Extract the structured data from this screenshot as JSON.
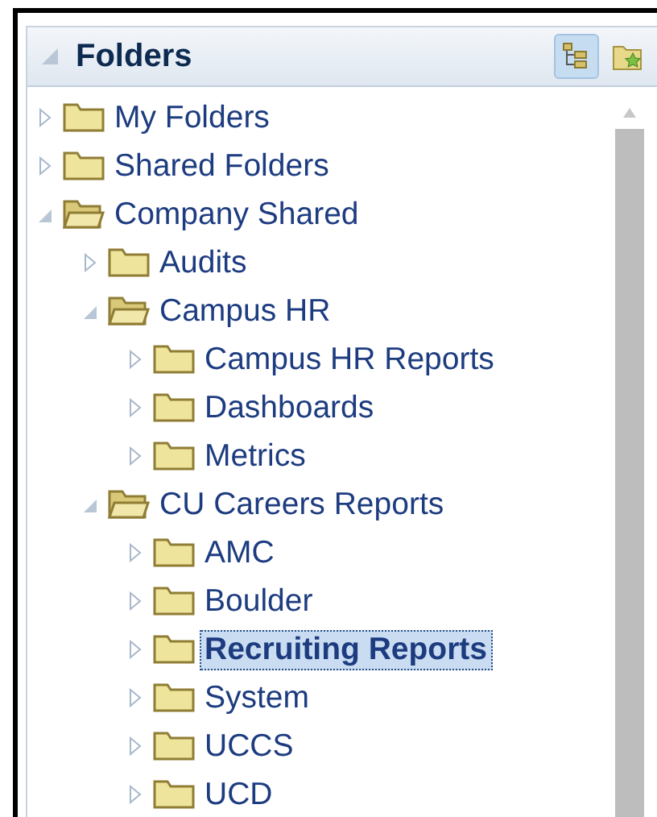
{
  "panel": {
    "title": "Folders",
    "tools": [
      {
        "kind": "tree",
        "selected": true
      },
      {
        "kind": "favorites",
        "selected": false
      }
    ]
  },
  "tree": [
    {
      "label": "My Folders",
      "expanded": false,
      "selected": false
    },
    {
      "label": "Shared Folders",
      "expanded": false,
      "selected": false
    },
    {
      "label": "Company Shared",
      "expanded": true,
      "selected": false,
      "children": [
        {
          "label": "Audits",
          "expanded": false,
          "selected": false
        },
        {
          "label": "Campus HR",
          "expanded": true,
          "selected": false,
          "children": [
            {
              "label": "Campus HR Reports",
              "expanded": false,
              "selected": false
            },
            {
              "label": "Dashboards",
              "expanded": false,
              "selected": false
            },
            {
              "label": "Metrics",
              "expanded": false,
              "selected": false
            }
          ]
        },
        {
          "label": "CU Careers Reports",
          "expanded": true,
          "selected": false,
          "children": [
            {
              "label": "AMC",
              "expanded": false,
              "selected": false
            },
            {
              "label": "Boulder",
              "expanded": false,
              "selected": false
            },
            {
              "label": "Recruiting Reports",
              "expanded": false,
              "selected": true
            },
            {
              "label": "System",
              "expanded": false,
              "selected": false
            },
            {
              "label": "UCCS",
              "expanded": false,
              "selected": false
            },
            {
              "label": "UCD",
              "expanded": false,
              "selected": false
            }
          ]
        }
      ]
    }
  ]
}
